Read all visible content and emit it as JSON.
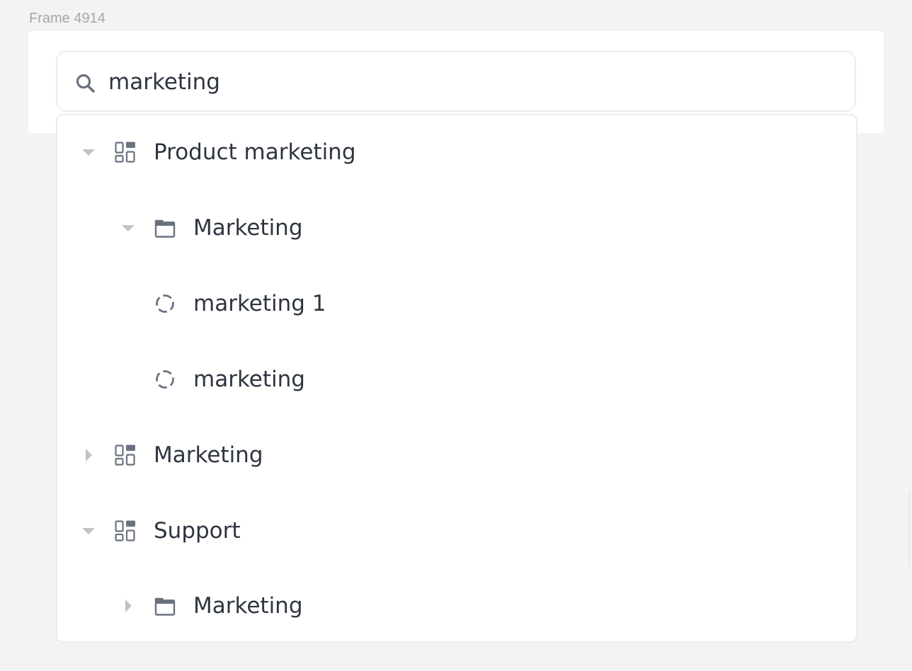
{
  "frame": {
    "label": "Frame 4914"
  },
  "search": {
    "value": "marketing",
    "icon": "search-icon"
  },
  "tree": {
    "rows": [
      {
        "label": "Product marketing",
        "depth": 0,
        "expanded": true,
        "caret": "caret-down",
        "icon": "collection-icon"
      },
      {
        "label": "Marketing",
        "depth": 1,
        "expanded": true,
        "caret": "caret-down",
        "icon": "folder-icon"
      },
      {
        "label": "marketing 1",
        "depth": 2,
        "caret": "none",
        "icon": "dashed-circle-icon"
      },
      {
        "label": "marketing",
        "depth": 2,
        "caret": "none",
        "icon": "dashed-circle-icon"
      },
      {
        "label": "Marketing",
        "depth": 0,
        "expanded": false,
        "caret": "caret-right",
        "icon": "collection-icon"
      },
      {
        "label": "Support",
        "depth": 0,
        "expanded": true,
        "caret": "caret-down",
        "icon": "collection-icon"
      },
      {
        "label": "Marketing",
        "depth": 1,
        "expanded": false,
        "caret": "caret-right",
        "icon": "folder-icon"
      }
    ]
  },
  "colors": {
    "text": "#2e3440",
    "icon": "#6b7280",
    "caret": "#c3c3c3",
    "border": "#ebebeb",
    "frameLabel": "#a7a7a7"
  }
}
